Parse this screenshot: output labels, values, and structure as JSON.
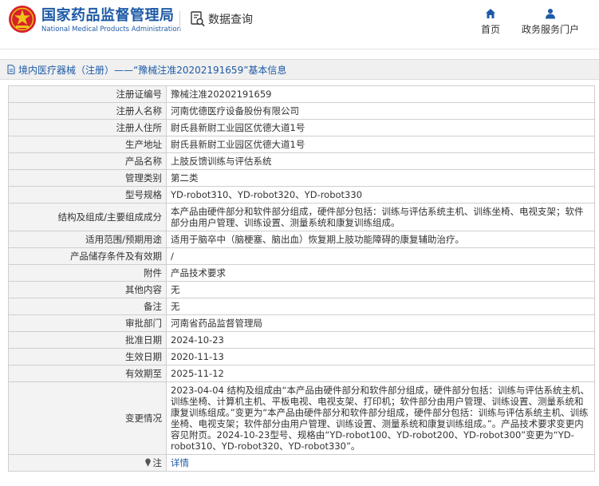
{
  "header": {
    "logo_cn": "国家药品监督管理局",
    "logo_en": "National Medical Products Administration",
    "db_label": "数据查询",
    "nav": [
      {
        "label": "首页",
        "icon": "home-icon"
      },
      {
        "label": "政务服务门户",
        "icon": "user-icon"
      }
    ]
  },
  "breadcrumb": "境内医疗器械（注册）——“豫械注准20202191659”基本信息",
  "rows": [
    {
      "key": "注册证编号",
      "value": "豫械注准20202191659"
    },
    {
      "key": "注册人名称",
      "value": "河南优德医疗设备股份有限公司"
    },
    {
      "key": "注册人住所",
      "value": "尉氏县新尉工业园区优德大道1号"
    },
    {
      "key": "生产地址",
      "value": "尉氏县新尉工业园区优德大道1号"
    },
    {
      "key": "产品名称",
      "value": "上肢反馈训练与评估系统"
    },
    {
      "key": "管理类别",
      "value": "第二类"
    },
    {
      "key": "型号规格",
      "value": "YD-robot310、YD-robot320、YD-robot330"
    },
    {
      "key": "结构及组成/主要组成成分",
      "value": "本产品由硬件部分和软件部分组成，硬件部分包括：训练与评估系统主机、训练坐椅、电视支架；软件部分由用户管理、训练设置、测量系统和康复训练组成。"
    },
    {
      "key": "适用范围/预期用途",
      "value": "适用于脑卒中（脑梗塞、脑出血）恢复期上肢功能障碍的康复辅助治疗。"
    },
    {
      "key": "产品储存条件及有效期",
      "value": "/"
    },
    {
      "key": "附件",
      "value": "产品技术要求"
    },
    {
      "key": "其他内容",
      "value": "无"
    },
    {
      "key": "备注",
      "value": "无"
    },
    {
      "key": "审批部门",
      "value": "河南省药品监督管理局"
    },
    {
      "key": "批准日期",
      "value": "2024-10-23"
    },
    {
      "key": "生效日期",
      "value": "2020-11-13"
    },
    {
      "key": "有效期至",
      "value": "2025-11-12"
    },
    {
      "key": "变更情况",
      "value": "2023-04-04 结构及组成由“本产品由硬件部分和软件部分组成，硬件部分包括：训练与评估系统主机、训练坐椅、计算机主机、平板电视、电视支架、打印机；软件部分由用户管理、训练设置、测量系统和康复训练组成。”变更为“本产品由硬件部分和软件部分组成，硬件部分包括：训练与评估系统主机、训练坐椅、电视支架；软件部分由用户管理、训练设置、测量系统和康复训练组成。”。产品技术要求变更内容见附页。2024-10-23型号、规格由“YD-robot100、YD-robot200、YD-robot300”变更为“YD-robot310、YD-robot320、YD-robot330”。"
    }
  ],
  "note": {
    "key": "注",
    "link": "详情"
  },
  "colors": {
    "brand": "#1d5aa6",
    "logo_red": "#d6232a",
    "logo_gold": "#f0c419"
  }
}
